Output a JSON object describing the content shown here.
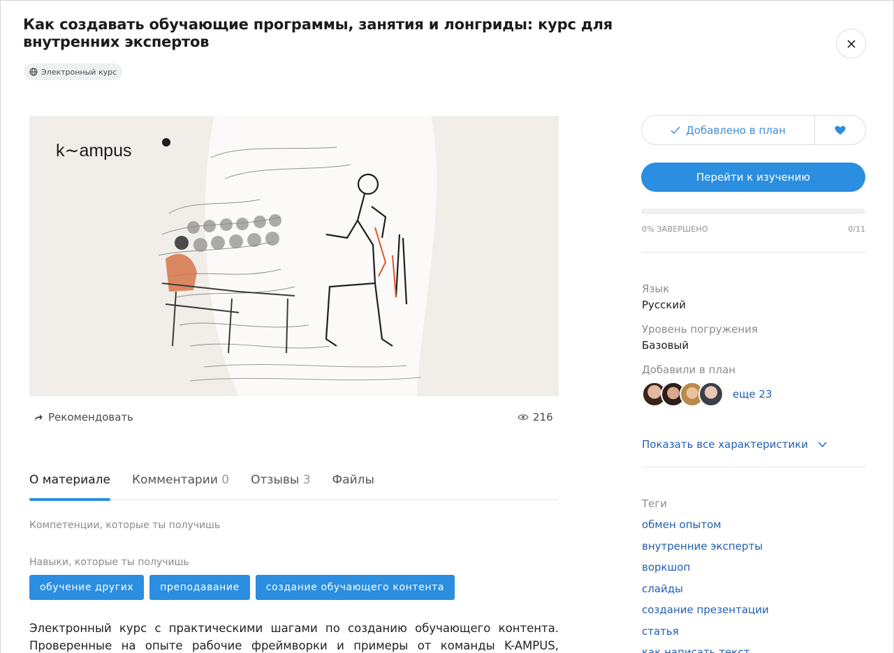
{
  "header": {
    "title": "Как создавать обучающие программы, занятия и лонгриды: курс для внутренних экспертов",
    "type_badge": "Электронный курс",
    "close_icon": "close-icon"
  },
  "cover": {
    "logo_text": "k∼ampus"
  },
  "actions": {
    "recommend_label": "Рекомендовать",
    "views": "216"
  },
  "tabs": [
    {
      "label": "О материале",
      "count": ""
    },
    {
      "label": "Комментарии",
      "count": "0"
    },
    {
      "label": "Отзывы",
      "count": "3"
    },
    {
      "label": "Файлы",
      "count": ""
    }
  ],
  "about": {
    "competencies_label": "Компетенции, которые ты получишь",
    "skills_label": "Навыки, которые ты получишь",
    "skills": [
      "обучение других",
      "преподавание",
      "создание обучающего контента"
    ],
    "description": "Электронный курс с практическими шагами по созданию обучающего контента. Проверенные на опыте рабочие фреймворки и примеры от команды K-AMPUS,"
  },
  "sidebar": {
    "plan_button": "Добавлено в план",
    "go_button": "Перейти к изучению",
    "progress_percent": 0,
    "progress_label": "0% ЗАВЕРШЕНО",
    "progress_count": "0/11",
    "language_label": "Язык",
    "language_value": "Русский",
    "level_label": "Уровень погружения",
    "level_value": "Базовый",
    "added_label": "Добавили в план",
    "added_more": "еще 23",
    "show_all": "Показать все характеристики",
    "tags_label": "Теги",
    "tags": [
      "обмен опытом",
      "внутренние эксперты",
      "воркшоп",
      "слайды",
      "создание презентации",
      "статья",
      "как написать текст"
    ]
  },
  "colors": {
    "accent": "#2b8ee0",
    "link": "#1f5fb0"
  }
}
